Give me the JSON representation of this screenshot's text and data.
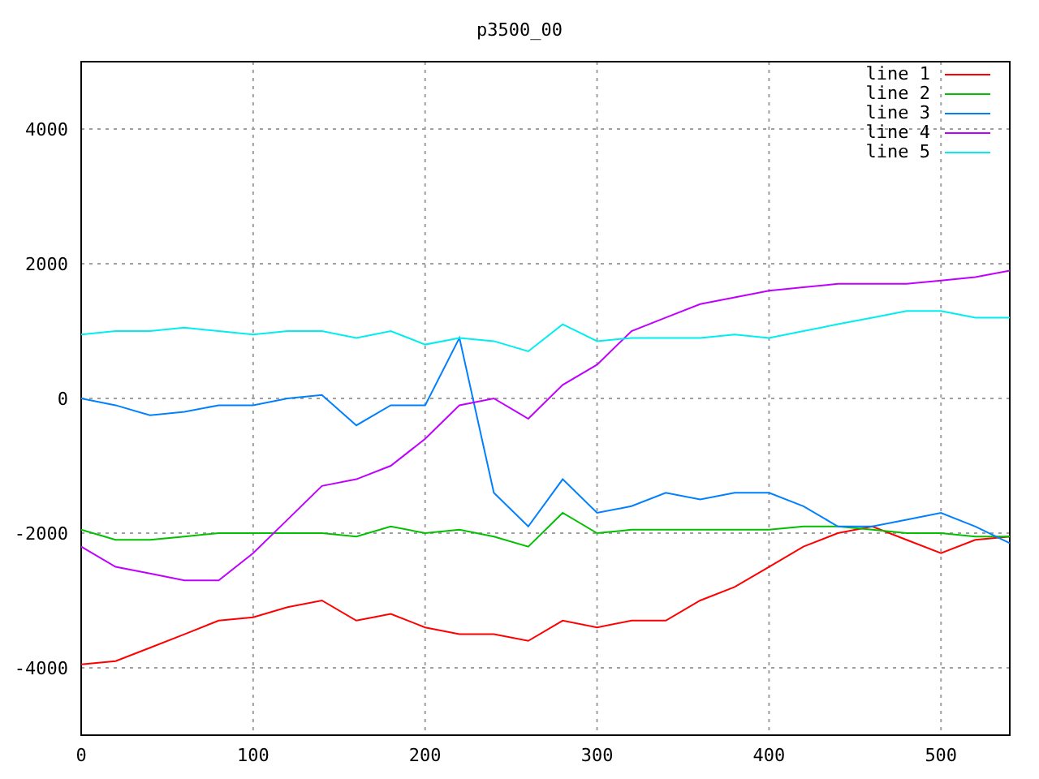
{
  "chart_data": {
    "type": "line",
    "title": "p3500_00",
    "x": [
      0,
      20,
      40,
      60,
      80,
      100,
      120,
      140,
      160,
      180,
      200,
      220,
      240,
      260,
      280,
      300,
      320,
      340,
      360,
      380,
      400,
      420,
      440,
      460,
      480,
      500,
      520,
      540
    ],
    "grid": true,
    "legend": true,
    "xlim": [
      0,
      540
    ],
    "ylim": [
      -5000,
      5000
    ],
    "xticks": [
      0,
      100,
      200,
      300,
      400,
      500
    ],
    "yticks": [
      -4000,
      -2000,
      0,
      2000,
      4000
    ],
    "series": [
      {
        "name": "line 1",
        "color": "#ff0000",
        "values": [
          -3950,
          -3900,
          -3700,
          -3500,
          -3300,
          -3250,
          -3100,
          -3000,
          -3300,
          -3200,
          -3400,
          -3500,
          -3500,
          -3600,
          -3300,
          -3400,
          -3300,
          -3300,
          -3000,
          -2800,
          -2500,
          -2200,
          -2000,
          -1900,
          -2100,
          -2300,
          -2100,
          -2050
        ]
      },
      {
        "name": "line 2",
        "color": "#00c000",
        "values": [
          -1950,
          -2100,
          -2100,
          -2050,
          -2000,
          -2000,
          -2000,
          -2000,
          -2050,
          -1900,
          -2000,
          -1950,
          -2050,
          -2200,
          -1700,
          -2000,
          -1950,
          -1950,
          -1950,
          -1950,
          -1950,
          -1900,
          -1900,
          -1950,
          -2000,
          -2000,
          -2050,
          -2050
        ]
      },
      {
        "name": "line 3",
        "color": "#0080ff",
        "values": [
          0,
          -100,
          -250,
          -200,
          -100,
          -100,
          0,
          50,
          -400,
          -100,
          -100,
          900,
          -1400,
          -1900,
          -1200,
          -1700,
          -1600,
          -1400,
          -1500,
          -1400,
          -1400,
          -1600,
          -1900,
          -1900,
          -1800,
          -1700,
          -1900,
          -2150
        ]
      },
      {
        "name": "line 4",
        "color": "#c000ff",
        "values": [
          -2200,
          -2500,
          -2600,
          -2700,
          -2700,
          -2300,
          -1800,
          -1300,
          -1200,
          -1000,
          -600,
          -100,
          0,
          -300,
          200,
          500,
          1000,
          1200,
          1400,
          1500,
          1600,
          1650,
          1700,
          1700,
          1700,
          1750,
          1800,
          1900
        ]
      },
      {
        "name": "line 5",
        "color": "#00eeee",
        "values": [
          950,
          1000,
          1000,
          1050,
          1000,
          950,
          1000,
          1000,
          900,
          1000,
          800,
          900,
          850,
          700,
          1100,
          850,
          900,
          900,
          900,
          950,
          900,
          1000,
          1100,
          1200,
          1300,
          1300,
          1200,
          1200
        ]
      }
    ]
  }
}
